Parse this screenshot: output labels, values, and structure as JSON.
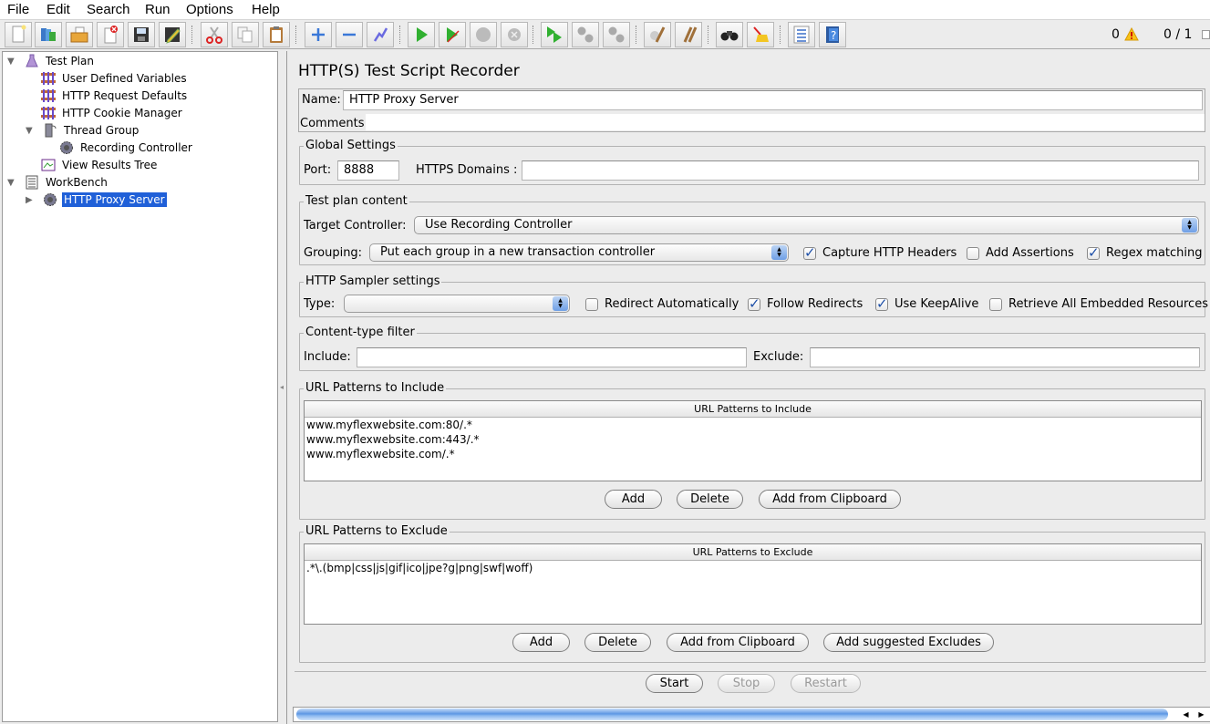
{
  "menubar": [
    "File",
    "Edit",
    "Search",
    "Run",
    "Options",
    "Help"
  ],
  "toolbar": {
    "buttons": [
      {
        "icon": "new-icon",
        "label": "New"
      },
      {
        "icon": "templates-icon",
        "label": "Templates"
      },
      {
        "icon": "open-icon",
        "label": "Open"
      },
      {
        "icon": "close-icon",
        "label": "Close"
      },
      {
        "icon": "save-icon",
        "label": "Save"
      },
      {
        "icon": "save-as-icon",
        "label": "Save as"
      },
      {
        "icon": "cut-icon",
        "label": "Cut"
      },
      {
        "icon": "copy-icon",
        "label": "Copy"
      },
      {
        "icon": "paste-icon",
        "label": "Paste"
      },
      {
        "icon": "expand-icon",
        "label": "Expand all"
      },
      {
        "icon": "collapse-icon",
        "label": "Collapse all"
      },
      {
        "icon": "toggle-icon",
        "label": "Toggle"
      },
      {
        "icon": "start-icon",
        "label": "Start"
      },
      {
        "icon": "start-no-timers-icon",
        "label": "Start no pauses"
      },
      {
        "icon": "stop-icon",
        "label": "Stop"
      },
      {
        "icon": "shutdown-icon",
        "label": "Shutdown"
      },
      {
        "icon": "remote-start-icon",
        "label": "Remote start all"
      },
      {
        "icon": "remote-stop-icon",
        "label": "Remote stop all"
      },
      {
        "icon": "remote-shutdown-icon",
        "label": "Remote shutdown all"
      },
      {
        "icon": "clear-icon",
        "label": "Clear"
      },
      {
        "icon": "clear-all-icon",
        "label": "Clear all"
      },
      {
        "icon": "search-icon",
        "label": "Search"
      },
      {
        "icon": "reset-search-icon",
        "label": "Reset search"
      },
      {
        "icon": "function-helper-icon",
        "label": "Function helper"
      },
      {
        "icon": "help-icon",
        "label": "Help"
      }
    ],
    "warning_count": "0",
    "threads": "0 / 1"
  },
  "tree": {
    "nodes": [
      {
        "label": "Test Plan",
        "icon": "test-plan-icon",
        "expanded": true
      },
      {
        "label": "User Defined Variables",
        "icon": "config-element-icon"
      },
      {
        "label": "HTTP Request Defaults",
        "icon": "config-element-icon"
      },
      {
        "label": "HTTP Cookie Manager",
        "icon": "config-element-icon"
      },
      {
        "label": "Thread Group",
        "icon": "thread-group-icon",
        "expanded": true
      },
      {
        "label": "Recording Controller",
        "icon": "controller-icon"
      },
      {
        "label": "View Results Tree",
        "icon": "listener-icon"
      },
      {
        "label": "WorkBench",
        "icon": "workbench-icon",
        "expanded": true
      },
      {
        "label": "HTTP Proxy Server",
        "icon": "controller-icon",
        "selected": true,
        "expanded": false
      }
    ]
  },
  "panel": {
    "title": "HTTP(S) Test Script Recorder",
    "name_label": "Name:",
    "name_value": "HTTP Proxy Server",
    "comments_label": "Comments:",
    "comments_value": "",
    "global": {
      "legend": "Global Settings",
      "port_label": "Port:",
      "port_value": "8888",
      "https_label": "HTTPS Domains :",
      "https_value": ""
    },
    "content": {
      "legend": "Test plan content",
      "target_label": "Target Controller:",
      "target_value": "Use Recording Controller",
      "grouping_label": "Grouping:",
      "grouping_value": "Put each group in a new transaction controller",
      "capture_headers": {
        "label": "Capture HTTP Headers",
        "checked": true
      },
      "add_assertions": {
        "label": "Add Assertions",
        "checked": false
      },
      "regex_matching": {
        "label": "Regex matching",
        "checked": true
      }
    },
    "sampler": {
      "legend": "HTTP Sampler settings",
      "type_label": "Type:",
      "type_value": "",
      "redirect_auto": {
        "label": "Redirect Automatically",
        "checked": false
      },
      "follow_redirects": {
        "label": "Follow Redirects",
        "checked": true
      },
      "keepalive": {
        "label": "Use KeepAlive",
        "checked": true
      },
      "embedded": {
        "label": "Retrieve All Embedded Resources",
        "checked": false
      }
    },
    "ctfilter": {
      "legend": "Content-type filter",
      "include_label": "Include:",
      "include_value": "",
      "exclude_label": "Exclude:",
      "exclude_value": ""
    },
    "include": {
      "legend": "URL Patterns to Include",
      "header": "URL Patterns to Include",
      "rows": [
        "www.myflexwebsite.com:80/.*",
        "www.myflexwebsite.com:443/.*",
        "www.myflexwebsite.com/.*"
      ],
      "add": "Add",
      "delete": "Delete",
      "clipboard": "Add from Clipboard"
    },
    "exclude": {
      "legend": "URL Patterns to Exclude",
      "header": "URL Patterns to Exclude",
      "rows": [
        ".*\\.(bmp|css|js|gif|ico|jpe?g|png|swf|woff)"
      ],
      "add": "Add",
      "delete": "Delete",
      "clipboard": "Add from Clipboard",
      "suggested": "Add suggested Excludes"
    },
    "start": "Start",
    "stop": "Stop",
    "restart": "Restart"
  }
}
